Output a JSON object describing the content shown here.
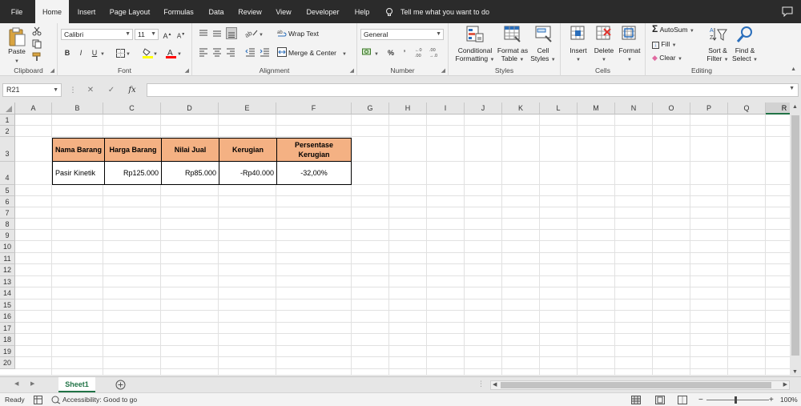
{
  "menu": {
    "tabs": [
      "File",
      "Home",
      "Insert",
      "Page Layout",
      "Formulas",
      "Data",
      "Review",
      "View",
      "Developer",
      "Help"
    ],
    "active": "Home",
    "tell_me": "Tell me what you want to do"
  },
  "ribbon": {
    "clipboard": {
      "label": "Clipboard",
      "paste": "Paste"
    },
    "font": {
      "label": "Font",
      "name": "Calibri",
      "size": "11",
      "bold": "B",
      "italic": "I",
      "underline": "U"
    },
    "alignment": {
      "label": "Alignment",
      "wrap_text": "Wrap Text",
      "merge_center": "Merge & Center"
    },
    "number": {
      "label": "Number",
      "format": "General",
      "percent": "%",
      "comma": "’",
      "inc": ".00",
      "dec": ".00"
    },
    "styles": {
      "label": "Styles",
      "conditional": [
        "Conditional",
        "Formatting"
      ],
      "format_table": [
        "Format as",
        "Table"
      ],
      "cell_styles": [
        "Cell",
        "Styles"
      ]
    },
    "cells": {
      "label": "Cells",
      "insert": "Insert",
      "delete": "Delete",
      "format": "Format"
    },
    "editing": {
      "label": "Editing",
      "autosum": "AutoSum",
      "fill": "Fill",
      "clear": "Clear",
      "sort": [
        "Sort &",
        "Filter"
      ],
      "find": [
        "Find &",
        "Select"
      ]
    }
  },
  "formula_bar": {
    "name_box": "R21",
    "fx": "fx",
    "content": ""
  },
  "grid": {
    "columns": [
      "A",
      "B",
      "C",
      "D",
      "E",
      "F",
      "G",
      "H",
      "I",
      "J",
      "K",
      "L",
      "M",
      "N",
      "O",
      "P",
      "Q",
      "R"
    ],
    "rows": [
      "1",
      "2",
      "3",
      "4",
      "5",
      "6",
      "7",
      "8",
      "9",
      "10",
      "11",
      "12",
      "13",
      "14",
      "15",
      "16",
      "17",
      "18",
      "19",
      "20"
    ],
    "selected_column": "R"
  },
  "table": {
    "headers": [
      "Nama Barang",
      "Harga Barang",
      "Nilai Jual",
      "Kerugian",
      "Persentase Kerugian"
    ],
    "header_fill": "#f4b183",
    "rows": [
      [
        "Pasir Kinetik",
        "Rp125.000",
        "Rp85.000",
        "-Rp40.000",
        "-32,00%"
      ]
    ]
  },
  "sheets": {
    "tabs": [
      "Sheet1"
    ],
    "active": "Sheet1"
  },
  "status": {
    "ready": "Ready",
    "accessibility": "Accessibility: Good to go",
    "zoom": "100%"
  },
  "colors": {
    "accent": "#217346",
    "menubar": "#2b2b2b"
  }
}
